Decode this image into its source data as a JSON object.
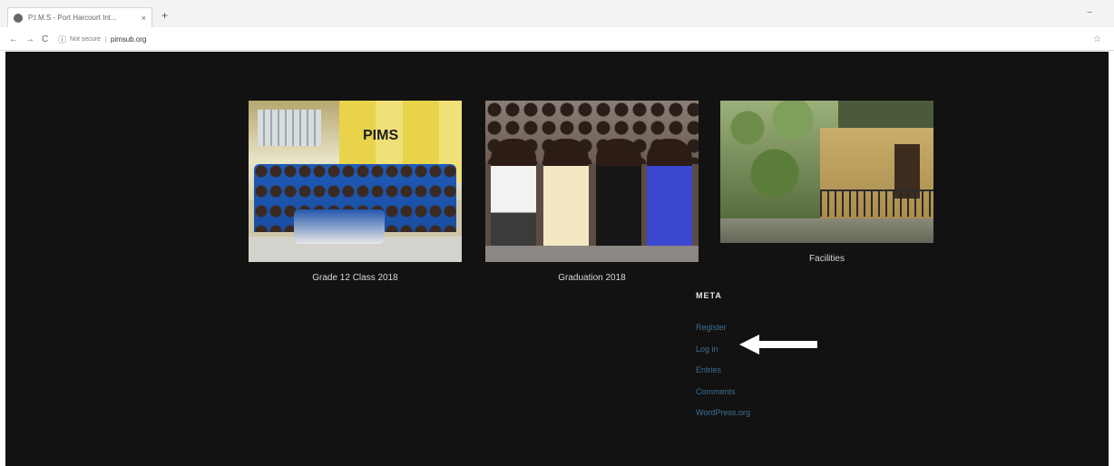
{
  "browser": {
    "tab_title": "P.I.M.S - Port Harcourt Int...",
    "tab_close": "×",
    "new_tab": "+",
    "window_min": "–",
    "nav_back": "←",
    "nav_forward": "→",
    "nav_reload": "C",
    "secure_label": "Not secure",
    "url": "pimsub.org",
    "bookmark_star": "☆"
  },
  "gallery": {
    "items": [
      {
        "caption": "Grade 12 Class 2018"
      },
      {
        "caption": "Graduation 2018"
      },
      {
        "caption": "Facilities"
      }
    ]
  },
  "meta_widget": {
    "title": "META",
    "links": [
      "Register",
      "Log in",
      "Entries",
      "Comments",
      "WordPress.org"
    ]
  },
  "colors": {
    "page_bg": "#121212",
    "link": "#3e6f93",
    "caption": "#d8d8d8",
    "annotation_arrow": "#ffffff"
  }
}
